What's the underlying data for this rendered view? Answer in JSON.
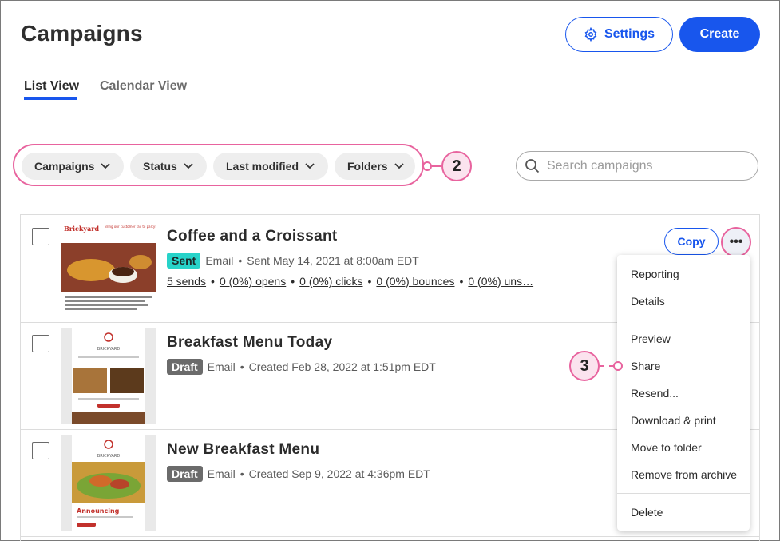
{
  "header": {
    "title": "Campaigns",
    "settings_label": "Settings",
    "create_label": "Create"
  },
  "tabs": [
    {
      "label": "List View",
      "active": true
    },
    {
      "label": "Calendar View",
      "active": false
    }
  ],
  "filters": [
    {
      "label": "Campaigns"
    },
    {
      "label": "Status"
    },
    {
      "label": "Last modified"
    },
    {
      "label": "Folders"
    }
  ],
  "search": {
    "placeholder": "Search campaigns",
    "value": ""
  },
  "callouts": {
    "filters": "2",
    "share": "3"
  },
  "campaigns": [
    {
      "title": "Coffee and a Croissant",
      "status": "Sent",
      "type": "Email",
      "date_text": "Sent May 14, 2021 at 8:00am EDT",
      "stats": [
        "5 sends",
        "0 (0%) opens",
        "0 (0%) clicks",
        "0 (0%) bounces",
        "0 (0%) uns…"
      ],
      "copy_label": "Copy"
    },
    {
      "title": "Breakfast Menu Today",
      "status": "Draft",
      "type": "Email",
      "date_text": "Created Feb 28, 2022 at 1:51pm EDT"
    },
    {
      "title": "New Breakfast Menu",
      "status": "Draft",
      "type": "Email",
      "date_text": "Created Sep 9, 2022 at 4:36pm EDT"
    }
  ],
  "menu": {
    "items": [
      "Reporting",
      "Details",
      "Preview",
      "Share",
      "Resend...",
      "Download & print",
      "Move to folder",
      "Remove from archive",
      "Delete"
    ]
  },
  "thumbnails": {
    "coffee": {
      "brand": "Brickyard",
      "headline": "Bring our customer fav to party!"
    },
    "breakfast": {
      "brand": "BRICKYARD"
    },
    "new_breakfast": {
      "brand": "BRICKYARD",
      "headline": "Announcing"
    }
  },
  "colors": {
    "accent": "#1856ed",
    "callout": "#e8639e",
    "sent": "#27d3c9",
    "draft": "#6b6b6b"
  }
}
